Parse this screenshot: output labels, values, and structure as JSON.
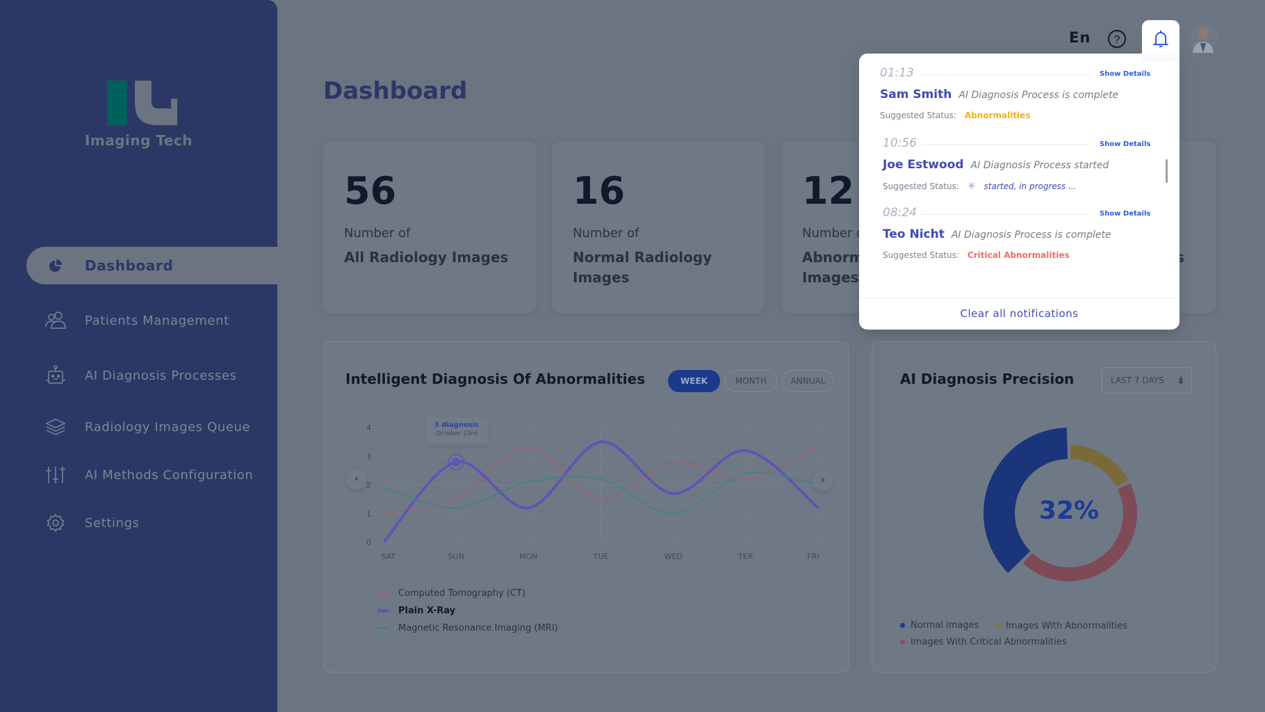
{
  "brand": {
    "name": "Imaging Tech"
  },
  "sidebar": {
    "items": [
      {
        "label": "Dashboard",
        "icon": "pie-chart-icon",
        "active": true
      },
      {
        "label": "Patients Management",
        "icon": "users-icon"
      },
      {
        "label": "AI Diagnosis Processes",
        "icon": "robot-icon"
      },
      {
        "label": "Radiology Images Queue",
        "icon": "layers-icon"
      },
      {
        "label": "AI Methods Configuration",
        "icon": "sliders-icon"
      },
      {
        "label": "Settings",
        "icon": "gear-icon"
      }
    ]
  },
  "header": {
    "language": "En",
    "help_icon": "help-icon",
    "bell_icon": "bell-icon",
    "avatar": "doctor-avatar"
  },
  "page": {
    "title": "Dashboard"
  },
  "cards": [
    {
      "value": "56",
      "sub": "Number of",
      "label": "All Radiology Images"
    },
    {
      "value": "16",
      "sub": "Number of",
      "label": "Normal Radiology Images"
    },
    {
      "value": "12",
      "sub": "Number of",
      "label": "Abnormal Radiology Images"
    },
    {
      "label": "s"
    }
  ],
  "diagnosis_panel": {
    "title": "Intelligent Diagnosis Of Abnormalities",
    "tabs": [
      "WEEK",
      "MONTH",
      "ANNUAL"
    ],
    "active_tab": "WEEK",
    "tooltip": {
      "title": "3 diagnosis",
      "date": "October 23rd"
    }
  },
  "precision_panel": {
    "title": "AI Diagnosis Precision",
    "select": "LAST 7 DAYS",
    "center_label": "32%"
  },
  "chart_data": [
    {
      "type": "line",
      "categories": [
        "SAT",
        "SUN",
        "MON",
        "TUE",
        "WED",
        "TER",
        "FRI"
      ],
      "ylim": [
        0,
        4
      ],
      "yticks": [
        "0",
        "1",
        "2",
        "3",
        "4"
      ],
      "grid": true,
      "legend": "bottom-left",
      "series": [
        {
          "name": "Computed Tomography (CT)",
          "color": "#9a6470",
          "values": [
            1.0,
            1.5,
            3.3,
            1.5,
            2.8,
            2.2,
            3.3
          ]
        },
        {
          "name": "Plain X-Ray",
          "color": "#5f55b5",
          "values": [
            0,
            2.8,
            1.2,
            3.5,
            1.7,
            3.2,
            1.2
          ],
          "highlight_index": 1
        },
        {
          "name": "Magnetic Resonance Imaging (MRI)",
          "color": "#3f8484",
          "values": [
            1.9,
            1.2,
            2.1,
            2.2,
            1.0,
            2.4,
            2.0
          ]
        }
      ]
    },
    {
      "type": "pie",
      "legend": "bottom",
      "center_label": "32%",
      "slices": [
        {
          "name": "Normal images",
          "color": "#1a3579",
          "value": 37
        },
        {
          "name": "Images With Abnormalities",
          "color": "#7a6a3a",
          "value": 17
        },
        {
          "name": "Images With Critical Abnormalities",
          "color": "#7d4a55",
          "value": 44
        }
      ]
    }
  ],
  "notifications": {
    "items": [
      {
        "time": "01:13",
        "name": "Sam Smith",
        "message": "AI Diagnosis Process is complete",
        "status_label": "Suggested Status:",
        "status": "Abnormalities",
        "status_color": "#f0b11b",
        "action": "Show Details"
      },
      {
        "time": "10:56",
        "name": "Joe Estwood",
        "message": "AI Diagnosis Process started",
        "status_label": "Suggested Status:",
        "status": "started, in progress ...",
        "status_color": "#3f4bb0",
        "action": "Show Details",
        "spinner": true
      },
      {
        "time": "08:24",
        "name": "Teo Nicht",
        "message": "AI Diagnosis Process is complete",
        "status_label": "Suggested Status:",
        "status": "Critical Abnormalities",
        "status_color": "#f56a6a",
        "action": "Show Details"
      }
    ],
    "clear_label": "Clear all notifications"
  }
}
